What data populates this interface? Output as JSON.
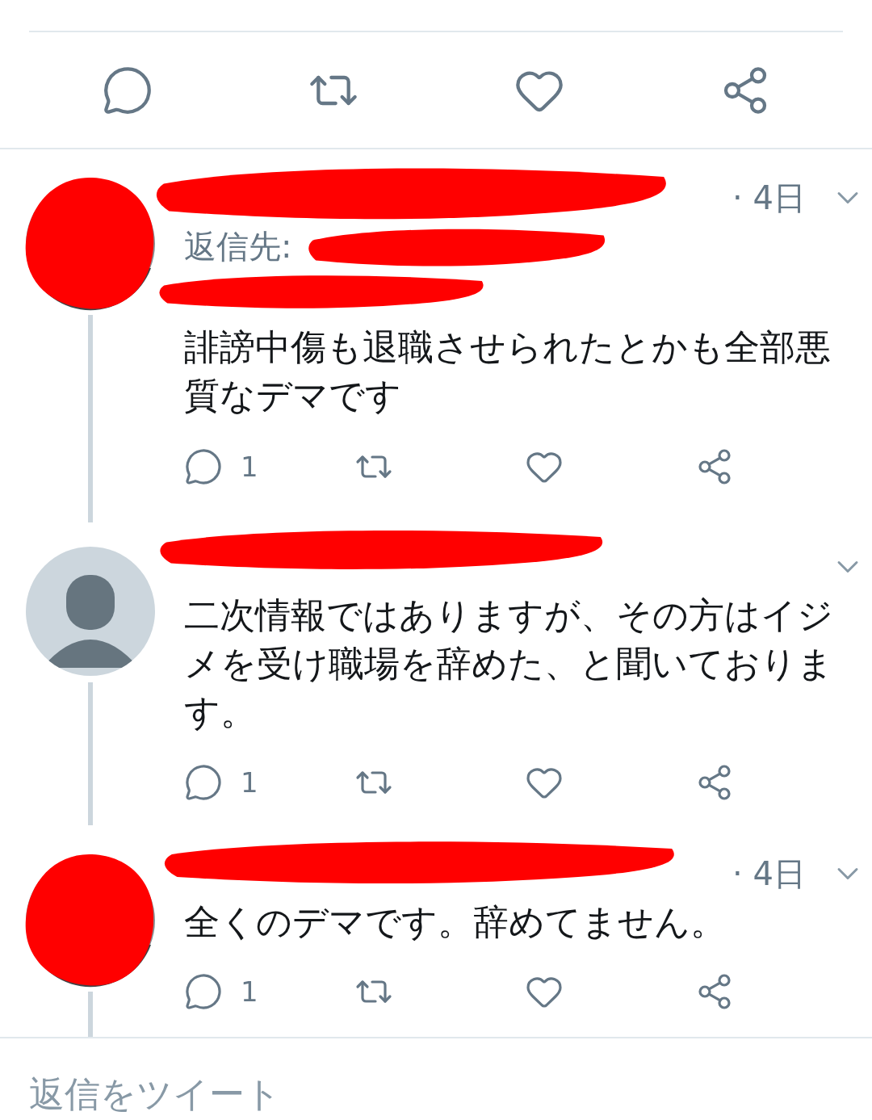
{
  "top_actions": [
    {
      "kind": "reply"
    },
    {
      "kind": "retweet"
    },
    {
      "kind": "like"
    },
    {
      "kind": "share"
    }
  ],
  "tweets": [
    {
      "avatar": {
        "kind": "picture",
        "redacted": true
      },
      "name_redacted": true,
      "time": "· 4日",
      "reply_to": "返信先:",
      "text": "誹謗中傷も退職させられたとかも全部悪質なデマです",
      "actions": [
        {
          "kind": "reply",
          "count": "1"
        },
        {
          "kind": "retweet"
        },
        {
          "kind": "like"
        },
        {
          "kind": "share"
        }
      ]
    },
    {
      "avatar": {
        "kind": "default",
        "redacted": false
      },
      "name_redacted": true,
      "text": "二次情報ではありますが、その方はイジメを受け職場を辞めた、と聞いております。",
      "actions": [
        {
          "kind": "reply",
          "count": "1"
        },
        {
          "kind": "retweet"
        },
        {
          "kind": "like"
        },
        {
          "kind": "share"
        }
      ]
    },
    {
      "avatar": {
        "kind": "picture",
        "redacted": true
      },
      "name_redacted": true,
      "time": "· 4日",
      "text": "全くのデマです。辞めてません。",
      "actions": [
        {
          "kind": "reply",
          "count": "1"
        },
        {
          "kind": "retweet"
        },
        {
          "kind": "like"
        },
        {
          "kind": "share"
        }
      ]
    }
  ],
  "compose": {
    "placeholder": "返信をツイート"
  }
}
